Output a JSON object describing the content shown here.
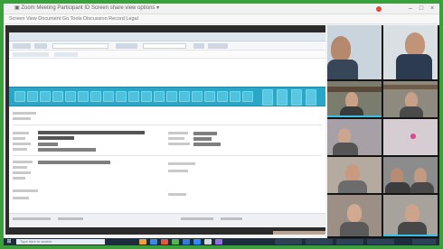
{
  "window": {
    "title": "Zoom Meeting — Screen sharing",
    "title_text": "▣ Zoom Meeting Participant ID   Screen share view options ▾"
  },
  "menu": {
    "text": "Screen   View   Document   Go   Tools   Discussion   Record   Legal"
  },
  "colors": {
    "desktop_border": "#3aa03c",
    "ribbon": "#2aa6c7",
    "end_button": "#e2462f",
    "taskbar": "#1e2d3d"
  },
  "toolbar": {
    "buttons": [
      {
        "icon": "mic-icon",
        "glyph": "●",
        "accent": true
      },
      {
        "icon": "video-icon",
        "glyph": "▶",
        "accent": false
      },
      {
        "icon": "participants-icon",
        "glyph": "☰",
        "accent": false
      },
      {
        "icon": "chat-icon",
        "glyph": "✉",
        "accent": false
      },
      {
        "icon": "share-icon",
        "glyph": "⇧",
        "accent": false
      },
      {
        "icon": "leave-icon",
        "glyph": "●",
        "accent": true
      }
    ]
  },
  "taskbar": {
    "search_placeholder": "Type here to search"
  }
}
